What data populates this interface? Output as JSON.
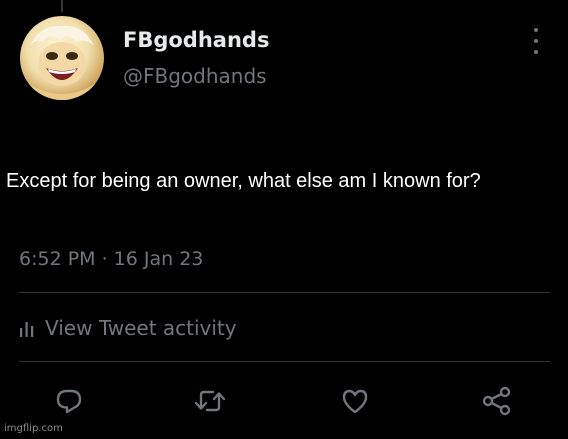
{
  "tweet": {
    "display_name": "FBgodhands",
    "handle": "@FBgodhands",
    "text": "Except for being an owner, what else am I known for?",
    "timestamp": "6:52 PM · 16 Jan 23"
  },
  "activity": {
    "label": "View Tweet activity"
  },
  "actions": {
    "reply_icon": "reply-icon",
    "retweet_icon": "retweet-icon",
    "like_icon": "heart-icon",
    "share_icon": "share-icon"
  },
  "watermark": "imgflip.com",
  "colors": {
    "background": "#000000",
    "primary_text": "#e7e9ea",
    "secondary_text": "#71767b",
    "divider": "#2f3336"
  }
}
